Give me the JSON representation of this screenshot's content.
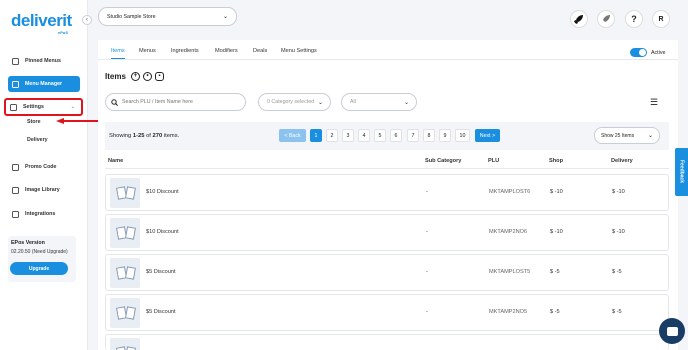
{
  "sidebar": {
    "logo": "deliverit",
    "logo_sub": "ePoS",
    "items": [
      {
        "label": "Pinned Menus"
      },
      {
        "label": "Menu Manager"
      },
      {
        "label": "Settings"
      },
      {
        "label": "Promo Code"
      },
      {
        "label": "Image Library"
      },
      {
        "label": "Integrations"
      }
    ],
    "sub_items": [
      {
        "label": "Store"
      },
      {
        "label": "Delivery"
      }
    ],
    "version_title": "EPos Version",
    "version_number": "02.20.50 (Need Upgrade)",
    "upgrade_label": "Upgrade"
  },
  "topbar": {
    "store": "Studio Sample Store",
    "user_initial": "R",
    "help": "?"
  },
  "tabs": [
    {
      "label": "Items"
    },
    {
      "label": "Menus"
    },
    {
      "label": "Ingredients"
    },
    {
      "label": "Modifiers"
    },
    {
      "label": "Deals"
    },
    {
      "label": "Menu Settings"
    }
  ],
  "status_label": "Active",
  "items_title": "Items",
  "search": {
    "placeholder": "Search PLU / Item Name here"
  },
  "category_select": "0 Category selected",
  "all_select": "All",
  "showing": {
    "prefix": "Showing ",
    "range": "1-25",
    "of": " of ",
    "total": "270",
    "suffix": " items."
  },
  "pagination": {
    "prev": "< Back",
    "pages": [
      "1",
      "2",
      "3",
      "4",
      "5",
      "6",
      "7",
      "8",
      "9",
      "10"
    ],
    "current": "1",
    "next": "Next >"
  },
  "per_page": "Show 25 Items",
  "columns": {
    "name": "Name",
    "sub_category": "Sub Category",
    "plu": "PLU",
    "shop": "Shop",
    "delivery": "Delivery"
  },
  "rows": [
    {
      "name": "$10 Discount",
      "sub_category": "-",
      "plu": "MKTAMPLOST6",
      "shop": "$ -10",
      "delivery": "$ -10"
    },
    {
      "name": "$10 Discount",
      "sub_category": "-",
      "plu": "MKTAMP2NO6",
      "shop": "$ -10",
      "delivery": "$ -10"
    },
    {
      "name": "$5 Discount",
      "sub_category": "-",
      "plu": "MKTAMPLOST5",
      "shop": "$ -5",
      "delivery": "$ -5"
    },
    {
      "name": "$5 Discount",
      "sub_category": "-",
      "plu": "MKTAMP2NO5",
      "shop": "$ -5",
      "delivery": "$ -5"
    }
  ],
  "feedback_label": "Feedback",
  "colors": {
    "accent": "#1a8fe0",
    "highlight": "#e0141e"
  }
}
